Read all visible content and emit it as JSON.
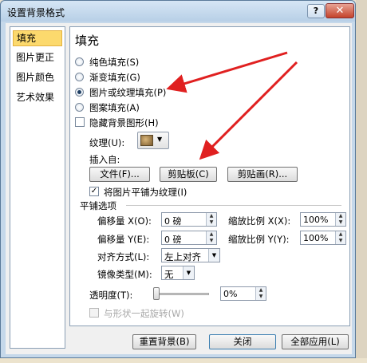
{
  "window": {
    "title": "设置背景格式",
    "help_label": "?",
    "close_label": "✕"
  },
  "nav": {
    "items": [
      {
        "label": "填充",
        "active": true
      },
      {
        "label": "图片更正",
        "active": false
      },
      {
        "label": "图片颜色",
        "active": false
      },
      {
        "label": "艺术效果",
        "active": false
      }
    ]
  },
  "fill": {
    "heading": "填充",
    "options": [
      {
        "label": "纯色填充(S)",
        "selected": false
      },
      {
        "label": "渐变填充(G)",
        "selected": false
      },
      {
        "label": "图片或纹理填充(P)",
        "selected": true
      },
      {
        "label": "图案填充(A)",
        "selected": false
      }
    ],
    "hide_bg_label": "隐藏背景图形(H)",
    "hide_bg_checked": false,
    "texture_label": "纹理(U):",
    "insert_from_label": "插入自:",
    "file_button": "文件(F)...",
    "clipboard_button": "剪贴板(C)",
    "clipart_button": "剪贴画(R)...",
    "tile_label": "将图片平铺为纹理(I)",
    "tile_checked": true,
    "tiling_section": "平铺选项",
    "offset_x_label": "偏移量 X(O):",
    "offset_x_value": "0 磅",
    "scale_x_label": "缩放比例 X(X):",
    "scale_x_value": "100%",
    "offset_y_label": "偏移量 Y(E):",
    "offset_y_value": "0 磅",
    "scale_y_label": "缩放比例 Y(Y):",
    "scale_y_value": "100%",
    "align_label": "对齐方式(L):",
    "align_value": "左上对齐",
    "mirror_label": "镜像类型(M):",
    "mirror_value": "无",
    "transparency_label": "透明度(T):",
    "transparency_value": "0%",
    "transparency_fraction": 0,
    "rotate_label": "与形状一起旋转(W)",
    "rotate_checked": false
  },
  "footer": {
    "reset_button": "重置背景(B)",
    "close_button": "关闭",
    "apply_all_button": "全部应用(L)"
  },
  "colors": {
    "arrow": "#e02020",
    "nav_active": "#fcd96d"
  }
}
